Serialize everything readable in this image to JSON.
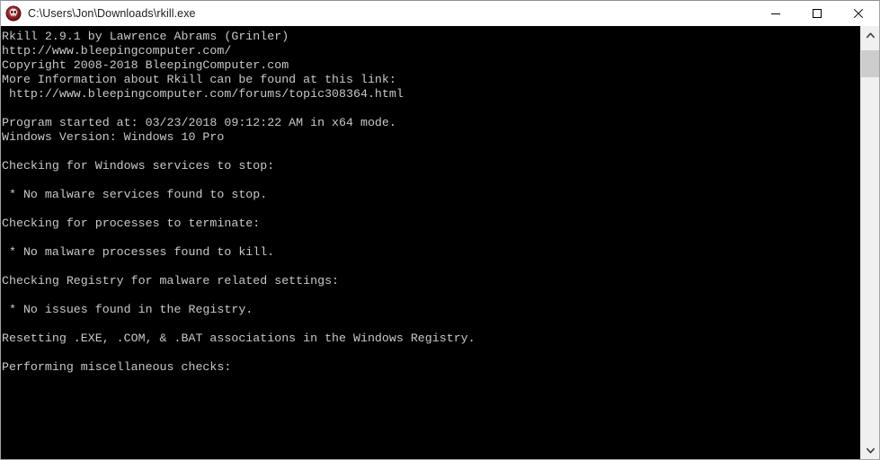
{
  "window": {
    "title": "C:\\Users\\Jon\\Downloads\\rkill.exe",
    "icon": "rkill-app-icon",
    "controls": {
      "minimize_label": "Minimize",
      "maximize_label": "Maximize",
      "close_label": "Close"
    }
  },
  "console": {
    "background_color": "#000000",
    "text_color": "#c8c8c8",
    "lines": [
      "Rkill 2.9.1 by Lawrence Abrams (Grinler)",
      "http://www.bleepingcomputer.com/",
      "Copyright 2008-2018 BleepingComputer.com",
      "More Information about Rkill can be found at this link:",
      " http://www.bleepingcomputer.com/forums/topic308364.html",
      "",
      "Program started at: 03/23/2018 09:12:22 AM in x64 mode.",
      "Windows Version: Windows 10 Pro",
      "",
      "Checking for Windows services to stop:",
      "",
      " * No malware services found to stop.",
      "",
      "Checking for processes to terminate:",
      "",
      " * No malware processes found to kill.",
      "",
      "Checking Registry for malware related settings:",
      "",
      " * No issues found in the Registry.",
      "",
      "Resetting .EXE, .COM, & .BAT associations in the Windows Registry.",
      "",
      "Performing miscellaneous checks:"
    ],
    "program_name": "Rkill",
    "version": "2.9.1",
    "author": "Lawrence Abrams (Grinler)",
    "homepage": "http://www.bleepingcomputer.com/",
    "copyright": "Copyright 2008-2018 BleepingComputer.com",
    "info_link": "http://www.bleepingcomputer.com/forums/topic308364.html",
    "started_at": "03/23/2018 09:12:22 AM",
    "mode": "x64",
    "windows_version": "Windows 10 Pro"
  },
  "scrollbar": {
    "up_arrow": "chevron-up-icon",
    "down_arrow": "chevron-down-icon",
    "thumb_label": "scrollbar-thumb"
  }
}
